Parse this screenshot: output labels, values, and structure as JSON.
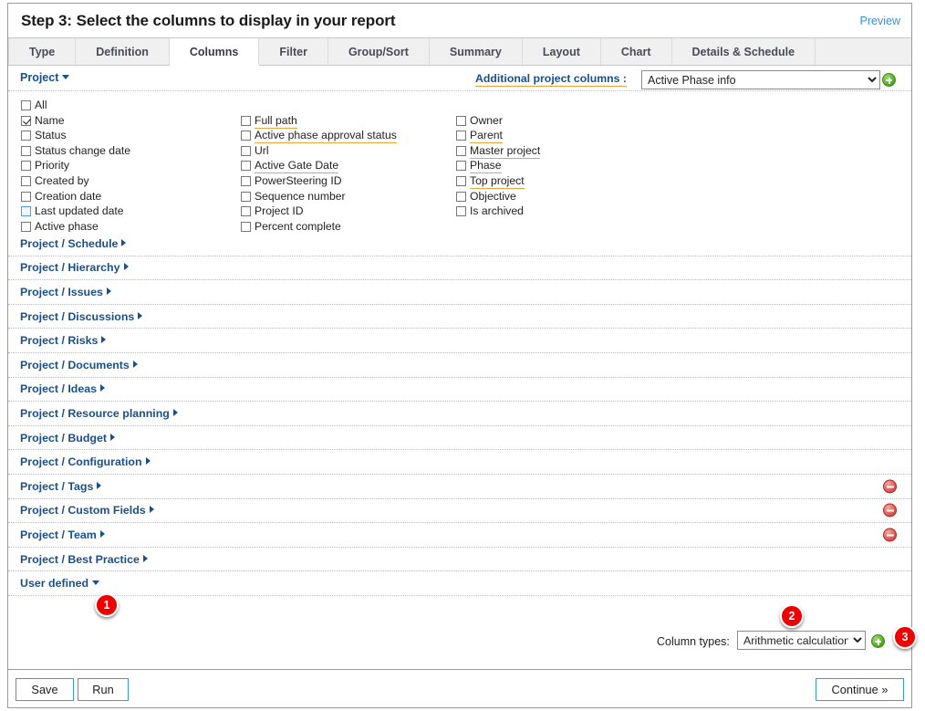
{
  "header": {
    "title": "Step 3: Select the columns to display in your report",
    "preview_label": "Preview"
  },
  "tabs": [
    {
      "label": "Type",
      "active": false
    },
    {
      "label": "Definition",
      "active": false
    },
    {
      "label": "Columns",
      "active": true
    },
    {
      "label": "Filter",
      "active": false
    },
    {
      "label": "Group/Sort",
      "active": false
    },
    {
      "label": "Summary",
      "active": false
    },
    {
      "label": "Layout",
      "active": false
    },
    {
      "label": "Chart",
      "active": false
    },
    {
      "label": "Details & Schedule",
      "active": false
    }
  ],
  "project_header": {
    "group_label": "Project",
    "additional_columns_label": "Additional project columns :",
    "additional_columns_value": "Active Phase info",
    "additional_columns_options": [
      "Active Phase info"
    ],
    "add_icon": "green-plus-icon"
  },
  "columns": [
    {
      "items": [
        {
          "label": "All",
          "checked": false,
          "focused": false,
          "underlined": false
        },
        {
          "label": "Name",
          "checked": true,
          "focused": false,
          "underlined": false
        },
        {
          "label": "Status",
          "checked": false,
          "focused": false,
          "underlined": false
        },
        {
          "label": "Status change date",
          "checked": false,
          "focused": false,
          "underlined": false
        },
        {
          "label": "Priority",
          "checked": false,
          "focused": false,
          "underlined": false
        },
        {
          "label": "Created by",
          "checked": false,
          "focused": false,
          "underlined": false
        },
        {
          "label": "Creation date",
          "checked": false,
          "focused": false,
          "underlined": false
        },
        {
          "label": "Last updated date",
          "checked": false,
          "focused": true,
          "underlined": false
        },
        {
          "label": "Active phase",
          "checked": false,
          "focused": false,
          "underlined": true
        }
      ]
    },
    {
      "offset": 1,
      "items": [
        {
          "label": "Full path",
          "checked": false,
          "focused": false,
          "underlined": true
        },
        {
          "label": "Active phase approval status",
          "checked": false,
          "focused": false,
          "underlined": true
        },
        {
          "label": "Url",
          "checked": false,
          "focused": false,
          "underlined": false
        },
        {
          "label": "Active Gate Date",
          "checked": false,
          "focused": false,
          "underlined": true
        },
        {
          "label": "PowerSteering ID",
          "checked": false,
          "focused": false,
          "underlined": false
        },
        {
          "label": "Sequence number",
          "checked": false,
          "focused": false,
          "underlined": false
        },
        {
          "label": "Project ID",
          "checked": false,
          "focused": false,
          "underlined": false
        },
        {
          "label": "Percent complete",
          "checked": false,
          "focused": false,
          "underlined": false
        }
      ]
    },
    {
      "offset": 1,
      "items": [
        {
          "label": "Owner",
          "checked": false,
          "focused": false,
          "underlined": false
        },
        {
          "label": "Parent",
          "checked": false,
          "focused": false,
          "underlined": true
        },
        {
          "label": "Master project",
          "checked": false,
          "focused": false,
          "underlined": true
        },
        {
          "label": "Phase",
          "checked": false,
          "focused": false,
          "underlined": true
        },
        {
          "label": "Top project",
          "checked": false,
          "focused": false,
          "underlined": true
        },
        {
          "label": "Objective",
          "checked": false,
          "focused": false,
          "underlined": false
        },
        {
          "label": "Is archived",
          "checked": false,
          "focused": false,
          "underlined": false
        }
      ]
    }
  ],
  "accordion": [
    {
      "label": "Project / Schedule",
      "expanded": false,
      "removable": false
    },
    {
      "label": "Project / Hierarchy",
      "expanded": false,
      "removable": false
    },
    {
      "label": "Project / Issues",
      "expanded": false,
      "removable": false
    },
    {
      "label": "Project / Discussions",
      "expanded": false,
      "removable": false
    },
    {
      "label": "Project / Risks",
      "expanded": false,
      "removable": false
    },
    {
      "label": "Project / Documents",
      "expanded": false,
      "removable": false
    },
    {
      "label": "Project / Ideas",
      "expanded": false,
      "removable": false
    },
    {
      "label": "Project / Resource planning",
      "expanded": false,
      "removable": false
    },
    {
      "label": "Project / Budget",
      "expanded": false,
      "removable": false
    },
    {
      "label": "Project / Configuration",
      "expanded": false,
      "removable": false
    },
    {
      "label": "Project / Tags",
      "expanded": false,
      "removable": true
    },
    {
      "label": "Project / Custom Fields",
      "expanded": false,
      "removable": true
    },
    {
      "label": "Project / Team",
      "expanded": false,
      "removable": true
    },
    {
      "label": "Project / Best Practice",
      "expanded": false,
      "removable": false
    },
    {
      "label": "User defined",
      "expanded": true,
      "removable": false
    }
  ],
  "column_types": {
    "label": "Column types:",
    "value": "Arithmetic calculation",
    "options": [
      "Arithmetic calculation"
    ],
    "add_icon": "green-plus-icon"
  },
  "badges": [
    {
      "number": "1"
    },
    {
      "number": "2"
    },
    {
      "number": "3"
    }
  ],
  "footer": {
    "save_label": "Save",
    "run_label": "Run",
    "continue_label": "Continue »"
  },
  "colors": {
    "link_blue": "#1b4f87",
    "preview_blue": "#3a8fd8",
    "underline_orange": "#e8a33d",
    "badge_red": "#ee0000",
    "remove_red": "#d44a42",
    "add_green": "#4ca521",
    "button_border": "#3a9ccc"
  }
}
